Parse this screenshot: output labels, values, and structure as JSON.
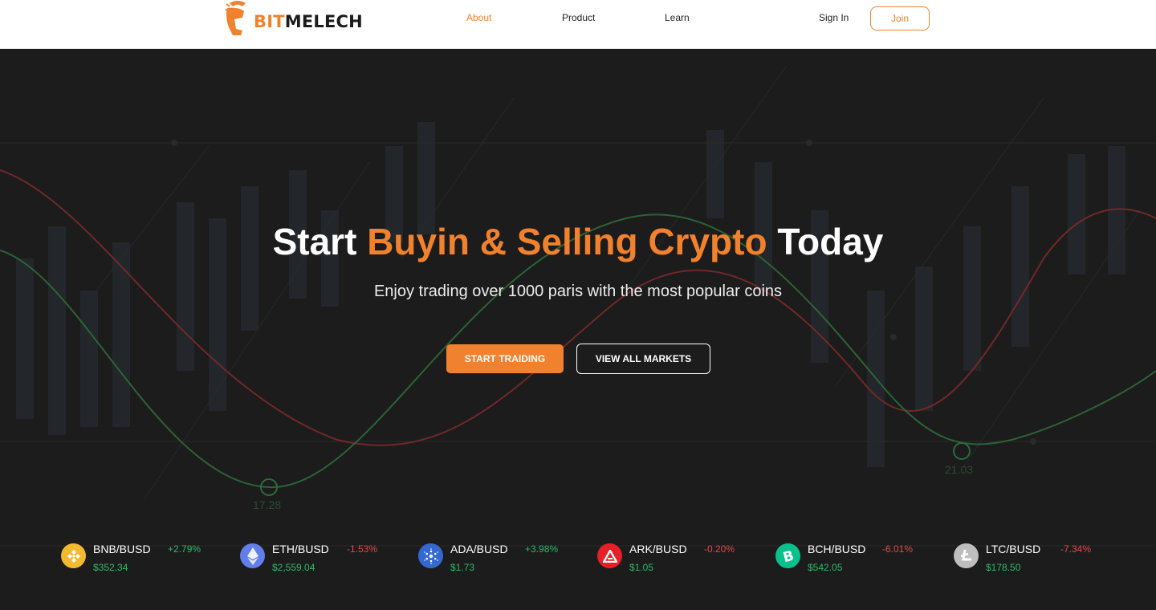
{
  "brand": {
    "part1": "BIT",
    "part2": "MELECH"
  },
  "nav": {
    "about": "About",
    "product": "Product",
    "learn": "Learn",
    "signin": "Sign In",
    "join": "Join"
  },
  "hero": {
    "title_start": "Start ",
    "title_accent": "Buyin & Selling Crypto",
    "title_end": " Today",
    "subtitle": "Enjoy trading over 1000 paris with the most popular coins",
    "start_button": "START TRAIDING",
    "markets_button": "VIEW ALL MARKETS",
    "bg_labels": {
      "left": "17.28",
      "right": "21.03"
    }
  },
  "colors": {
    "accent": "#f0812e",
    "positive": "#2dba6a",
    "negative": "#e04a4a",
    "background": "#1c1c1c"
  },
  "ticker": [
    {
      "pair": "BNB/BUSD",
      "change": "+2.79%",
      "price": "$352.34",
      "trend": "up",
      "icon": "bnb-icon",
      "icon_color": "#f3ba2f"
    },
    {
      "pair": "ETH/BUSD",
      "change": "-1.53%",
      "price": "$2,559.04",
      "trend": "down",
      "icon": "eth-icon",
      "icon_color": "#627eea"
    },
    {
      "pair": "ADA/BUSD",
      "change": "+3.98%",
      "price": "$1.73",
      "trend": "up",
      "icon": "ada-icon",
      "icon_color": "#3468d1"
    },
    {
      "pair": "ARK/BUSD",
      "change": "-0.20%",
      "price": "$1.05",
      "trend": "down",
      "icon": "ark-icon",
      "icon_color": "#e52027"
    },
    {
      "pair": "BCH/BUSD",
      "change": "-6.01%",
      "price": "$542.05",
      "trend": "down",
      "icon": "bch-icon",
      "icon_color": "#0ac18e"
    },
    {
      "pair": "LTC/BUSD",
      "change": "-7.34%",
      "price": "$178.50",
      "trend": "down",
      "icon": "ltc-icon",
      "icon_color": "#bebebe"
    }
  ]
}
